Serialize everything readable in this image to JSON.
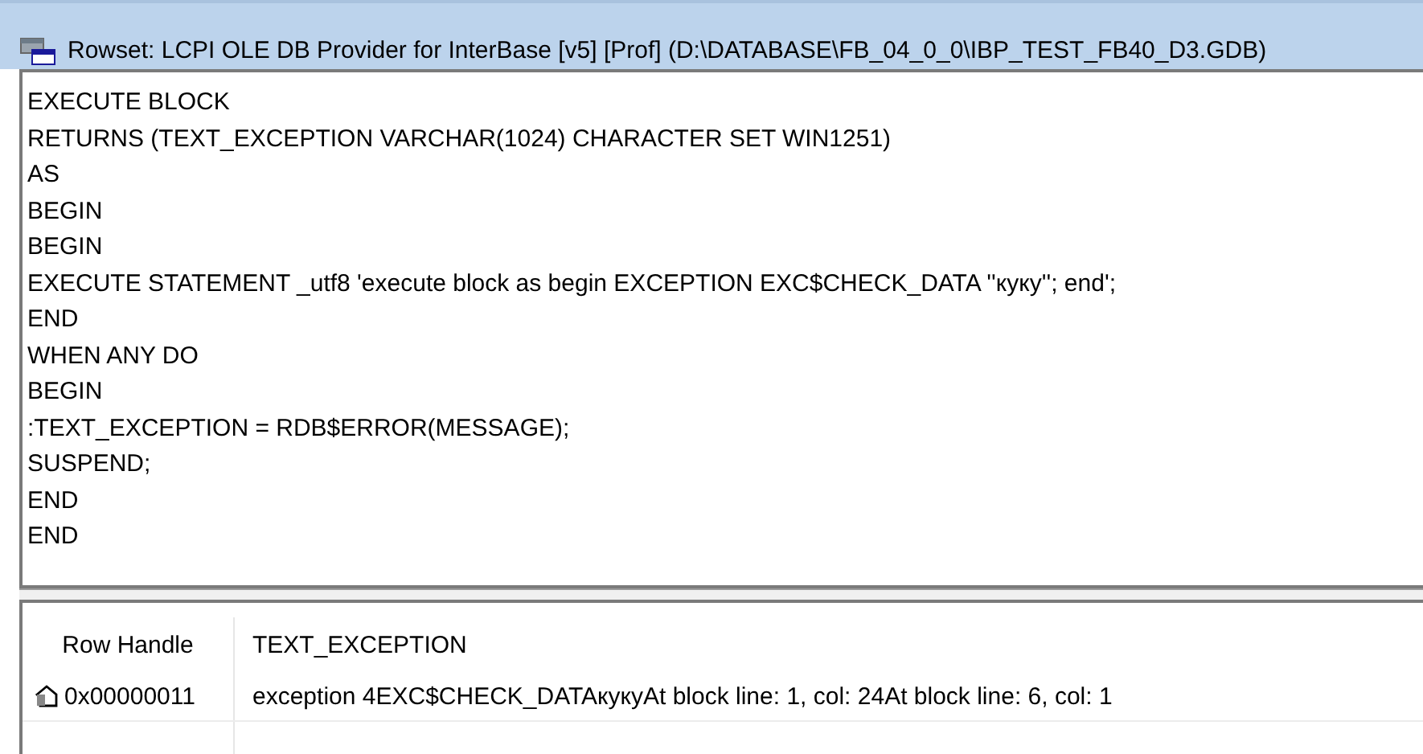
{
  "window": {
    "title": "Rowset: LCPI OLE DB Provider for InterBase [v5] [Prof] (D:\\DATABASE\\FB_04_0_0\\IBP_TEST_FB40_D3.GDB)"
  },
  "editor": {
    "lines": [
      "EXECUTE BLOCK",
      "RETURNS (TEXT_EXCEPTION VARCHAR(1024) CHARACTER SET WIN1251)",
      "AS",
      "BEGIN",
      "BEGIN",
      "EXECUTE STATEMENT _utf8 'execute block as begin EXCEPTION EXC$CHECK_DATA ''куку''; end';",
      "END",
      "WHEN ANY DO",
      "BEGIN",
      ":TEXT_EXCEPTION = RDB$ERROR(MESSAGE);",
      "SUSPEND;",
      "END",
      "END"
    ]
  },
  "grid": {
    "columns": [
      "Row Handle",
      "TEXT_EXCEPTION"
    ],
    "rows": [
      {
        "cells": [
          "0x00000011",
          "exception 4EXC$CHECK_DATAкукуAt block line: 1, col: 24At block line: 6, col: 1"
        ]
      }
    ]
  }
}
